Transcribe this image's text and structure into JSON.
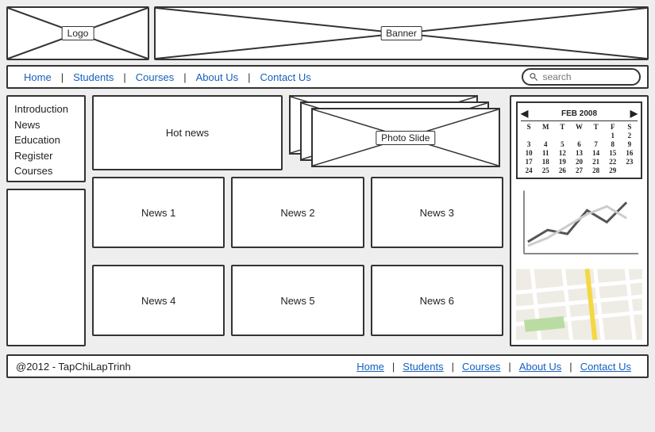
{
  "header": {
    "logo_label": "Logo",
    "banner_label": "Banner"
  },
  "nav": {
    "items": [
      "Home",
      "Students",
      "Courses",
      "About Us",
      "Contact Us"
    ],
    "search_placeholder": "search"
  },
  "sidebar": {
    "items": [
      "Introduction",
      "News",
      "Education",
      "Register",
      "Courses"
    ]
  },
  "content": {
    "hot_news_label": "Hot news",
    "photo_slide_label": "Photo Slide",
    "news_items": [
      "News 1",
      "News 2",
      "News 3",
      "News 4",
      "News 5",
      "News 6"
    ]
  },
  "calendar": {
    "month_label": "FEB 2008",
    "dow": [
      "S",
      "M",
      "T",
      "W",
      "T",
      "F",
      "S"
    ],
    "days": [
      "",
      "",
      "",
      "",
      "",
      "1",
      "2",
      "3",
      "4",
      "5",
      "6",
      "7",
      "8",
      "9",
      "10",
      "11",
      "12",
      "13",
      "14",
      "15",
      "16",
      "17",
      "18",
      "19",
      "20",
      "21",
      "22",
      "23",
      "24",
      "25",
      "26",
      "27",
      "28",
      "29"
    ]
  },
  "footer": {
    "copyright": "@2012 - TapChiLapTrinh",
    "links": [
      "Home",
      "Students",
      "Courses",
      "About Us",
      "Contact Us"
    ]
  },
  "chart_data": {
    "type": "line",
    "series": [
      {
        "name": "dark",
        "values": [
          20,
          35,
          30,
          60,
          45,
          70
        ]
      },
      {
        "name": "light",
        "values": [
          15,
          25,
          40,
          55,
          65,
          50
        ]
      }
    ],
    "xlim": [
      0,
      5
    ],
    "ylim": [
      0,
      80
    ]
  }
}
